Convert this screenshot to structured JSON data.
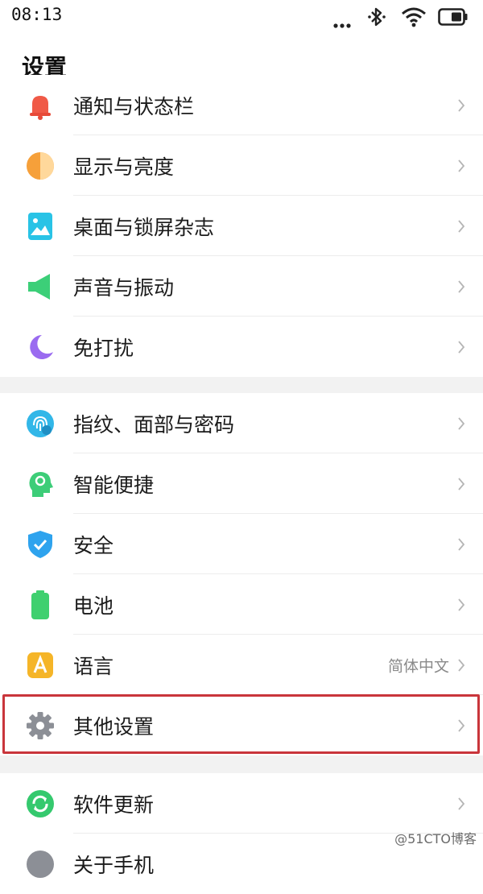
{
  "status_bar": {
    "time": "08:13",
    "icons": [
      "more-dots-icon",
      "bluetooth-icon",
      "wifi-icon",
      "battery-icon"
    ]
  },
  "header": {
    "title": "设置"
  },
  "groups": [
    {
      "items": [
        {
          "label": "通知与状态栏",
          "icon": "bell-icon",
          "color": "#f05a47"
        },
        {
          "label": "显示与亮度",
          "icon": "brightness-icon",
          "color": "#f6a03a"
        },
        {
          "label": "桌面与锁屏杂志",
          "icon": "wallpaper-icon",
          "color": "#29c3e6"
        },
        {
          "label": "声音与振动",
          "icon": "speaker-icon",
          "color": "#3ccf78"
        },
        {
          "label": "免打扰",
          "icon": "moon-icon",
          "color": "#9a6bf0"
        }
      ]
    },
    {
      "items": [
        {
          "label": "指纹、面部与密码",
          "icon": "fingerprint-icon",
          "color": "#32b7e8"
        },
        {
          "label": "智能便捷",
          "icon": "smart-head-icon",
          "color": "#3dcd78"
        },
        {
          "label": "安全",
          "icon": "shield-icon",
          "color": "#2ea3ee"
        },
        {
          "label": "电池",
          "icon": "battery-icon",
          "color": "#3fd06f"
        },
        {
          "label": "语言",
          "value": "简体中文",
          "icon": "language-icon",
          "color": "#f5b528"
        },
        {
          "label": "其他设置",
          "icon": "gear-icon",
          "color": "#8c8f96"
        }
      ]
    },
    {
      "items": [
        {
          "label": "软件更新",
          "icon": "update-icon",
          "color": "#35c96e"
        },
        {
          "label": "关于手机",
          "icon": "info-icon",
          "color": "#8c8f96"
        }
      ]
    }
  ],
  "watermark": "@51CTO博客"
}
